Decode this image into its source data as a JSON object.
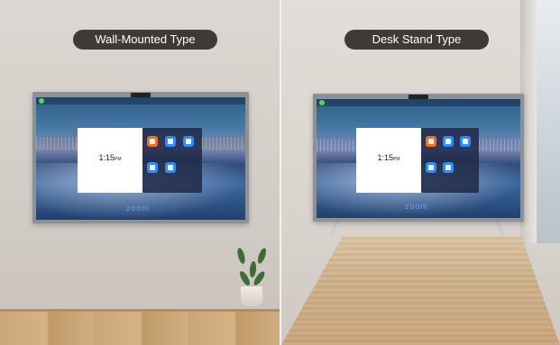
{
  "labels": {
    "left": "Wall-Mounted Type",
    "right": "Desk Stand Type"
  },
  "screen": {
    "time": "1:15",
    "meridiem": "PM",
    "brand": "zoom"
  },
  "icons": [
    "camera-icon",
    "share-screen-icon",
    "calendar-icon",
    "contacts-icon",
    "settings-icon"
  ],
  "colors": {
    "label_pill": "#3e3a37",
    "zoom_blue": "#2d8cff",
    "zoom_orange": "#f37021"
  }
}
